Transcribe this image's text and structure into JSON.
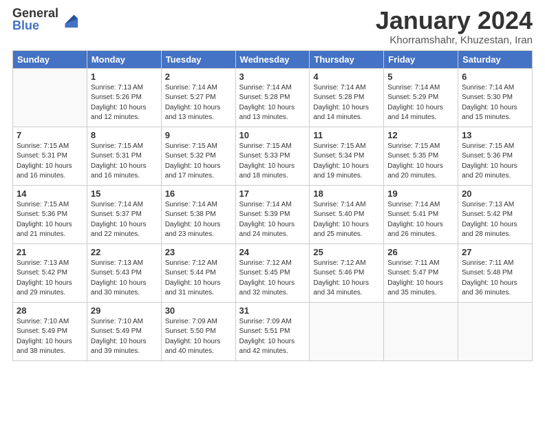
{
  "header": {
    "logo_general": "General",
    "logo_blue": "Blue",
    "main_title": "January 2024",
    "subtitle": "Khorramshahr, Khuzestan, Iran"
  },
  "weekdays": [
    "Sunday",
    "Monday",
    "Tuesday",
    "Wednesday",
    "Thursday",
    "Friday",
    "Saturday"
  ],
  "weeks": [
    [
      {
        "day": "",
        "info": ""
      },
      {
        "day": "1",
        "info": "Sunrise: 7:13 AM\nSunset: 5:26 PM\nDaylight: 10 hours\nand 12 minutes."
      },
      {
        "day": "2",
        "info": "Sunrise: 7:14 AM\nSunset: 5:27 PM\nDaylight: 10 hours\nand 13 minutes."
      },
      {
        "day": "3",
        "info": "Sunrise: 7:14 AM\nSunset: 5:28 PM\nDaylight: 10 hours\nand 13 minutes."
      },
      {
        "day": "4",
        "info": "Sunrise: 7:14 AM\nSunset: 5:28 PM\nDaylight: 10 hours\nand 14 minutes."
      },
      {
        "day": "5",
        "info": "Sunrise: 7:14 AM\nSunset: 5:29 PM\nDaylight: 10 hours\nand 14 minutes."
      },
      {
        "day": "6",
        "info": "Sunrise: 7:14 AM\nSunset: 5:30 PM\nDaylight: 10 hours\nand 15 minutes."
      }
    ],
    [
      {
        "day": "7",
        "info": "Sunrise: 7:15 AM\nSunset: 5:31 PM\nDaylight: 10 hours\nand 16 minutes."
      },
      {
        "day": "8",
        "info": "Sunrise: 7:15 AM\nSunset: 5:31 PM\nDaylight: 10 hours\nand 16 minutes."
      },
      {
        "day": "9",
        "info": "Sunrise: 7:15 AM\nSunset: 5:32 PM\nDaylight: 10 hours\nand 17 minutes."
      },
      {
        "day": "10",
        "info": "Sunrise: 7:15 AM\nSunset: 5:33 PM\nDaylight: 10 hours\nand 18 minutes."
      },
      {
        "day": "11",
        "info": "Sunrise: 7:15 AM\nSunset: 5:34 PM\nDaylight: 10 hours\nand 19 minutes."
      },
      {
        "day": "12",
        "info": "Sunrise: 7:15 AM\nSunset: 5:35 PM\nDaylight: 10 hours\nand 20 minutes."
      },
      {
        "day": "13",
        "info": "Sunrise: 7:15 AM\nSunset: 5:36 PM\nDaylight: 10 hours\nand 20 minutes."
      }
    ],
    [
      {
        "day": "14",
        "info": "Sunrise: 7:15 AM\nSunset: 5:36 PM\nDaylight: 10 hours\nand 21 minutes."
      },
      {
        "day": "15",
        "info": "Sunrise: 7:14 AM\nSunset: 5:37 PM\nDaylight: 10 hours\nand 22 minutes."
      },
      {
        "day": "16",
        "info": "Sunrise: 7:14 AM\nSunset: 5:38 PM\nDaylight: 10 hours\nand 23 minutes."
      },
      {
        "day": "17",
        "info": "Sunrise: 7:14 AM\nSunset: 5:39 PM\nDaylight: 10 hours\nand 24 minutes."
      },
      {
        "day": "18",
        "info": "Sunrise: 7:14 AM\nSunset: 5:40 PM\nDaylight: 10 hours\nand 25 minutes."
      },
      {
        "day": "19",
        "info": "Sunrise: 7:14 AM\nSunset: 5:41 PM\nDaylight: 10 hours\nand 26 minutes."
      },
      {
        "day": "20",
        "info": "Sunrise: 7:13 AM\nSunset: 5:42 PM\nDaylight: 10 hours\nand 28 minutes."
      }
    ],
    [
      {
        "day": "21",
        "info": "Sunrise: 7:13 AM\nSunset: 5:42 PM\nDaylight: 10 hours\nand 29 minutes."
      },
      {
        "day": "22",
        "info": "Sunrise: 7:13 AM\nSunset: 5:43 PM\nDaylight: 10 hours\nand 30 minutes."
      },
      {
        "day": "23",
        "info": "Sunrise: 7:12 AM\nSunset: 5:44 PM\nDaylight: 10 hours\nand 31 minutes."
      },
      {
        "day": "24",
        "info": "Sunrise: 7:12 AM\nSunset: 5:45 PM\nDaylight: 10 hours\nand 32 minutes."
      },
      {
        "day": "25",
        "info": "Sunrise: 7:12 AM\nSunset: 5:46 PM\nDaylight: 10 hours\nand 34 minutes."
      },
      {
        "day": "26",
        "info": "Sunrise: 7:11 AM\nSunset: 5:47 PM\nDaylight: 10 hours\nand 35 minutes."
      },
      {
        "day": "27",
        "info": "Sunrise: 7:11 AM\nSunset: 5:48 PM\nDaylight: 10 hours\nand 36 minutes."
      }
    ],
    [
      {
        "day": "28",
        "info": "Sunrise: 7:10 AM\nSunset: 5:49 PM\nDaylight: 10 hours\nand 38 minutes."
      },
      {
        "day": "29",
        "info": "Sunrise: 7:10 AM\nSunset: 5:49 PM\nDaylight: 10 hours\nand 39 minutes."
      },
      {
        "day": "30",
        "info": "Sunrise: 7:09 AM\nSunset: 5:50 PM\nDaylight: 10 hours\nand 40 minutes."
      },
      {
        "day": "31",
        "info": "Sunrise: 7:09 AM\nSunset: 5:51 PM\nDaylight: 10 hours\nand 42 minutes."
      },
      {
        "day": "",
        "info": ""
      },
      {
        "day": "",
        "info": ""
      },
      {
        "day": "",
        "info": ""
      }
    ]
  ]
}
